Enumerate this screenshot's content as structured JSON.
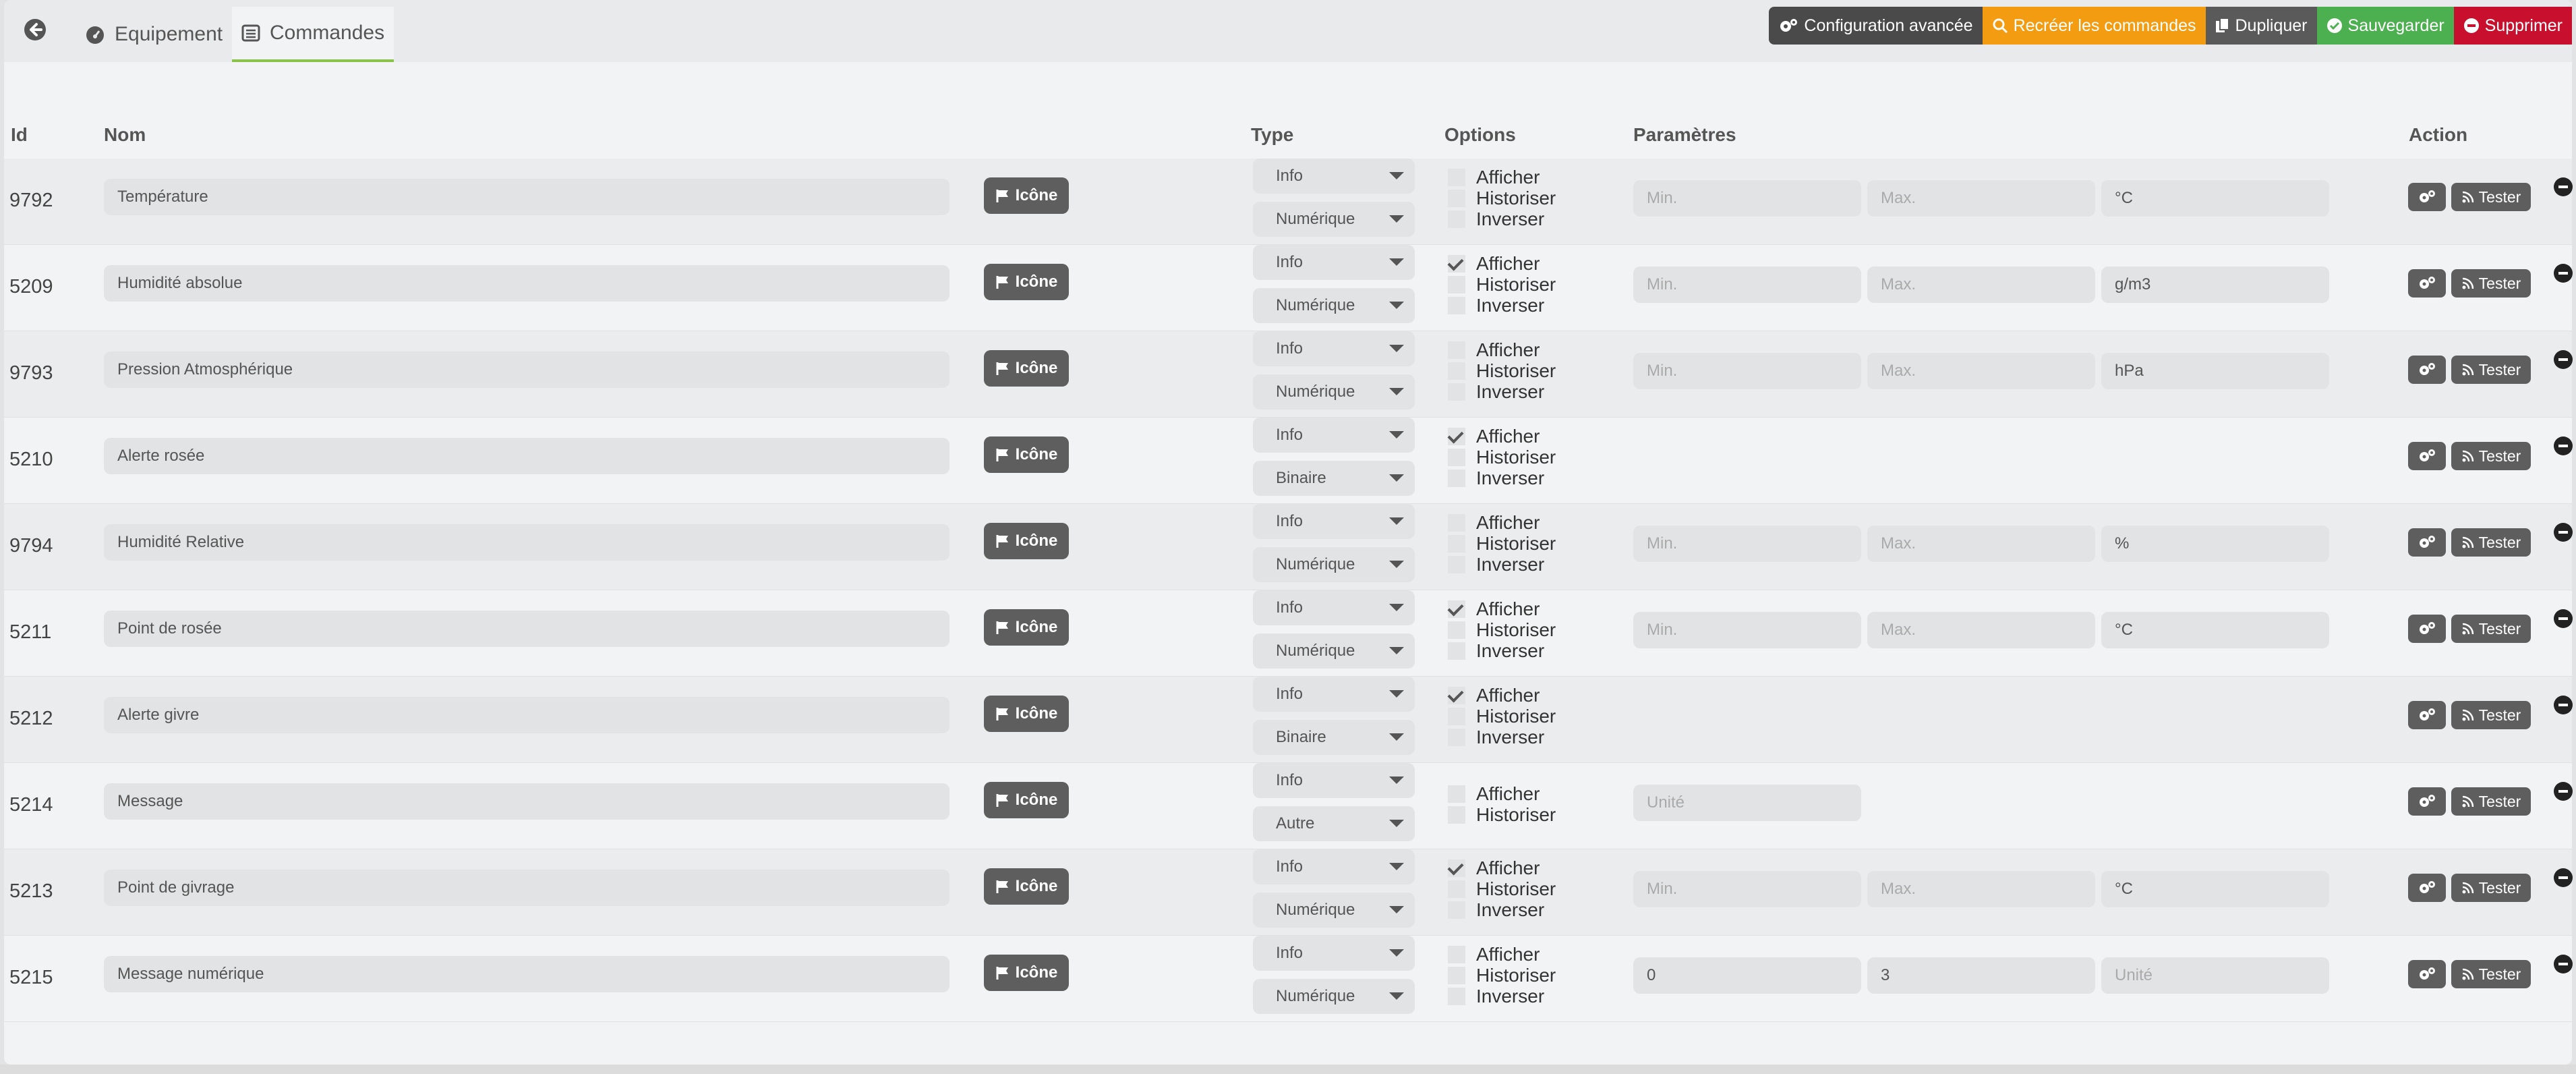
{
  "tabs": [
    {
      "label": "Equipement",
      "icon": "dashboard-icon"
    },
    {
      "label": "Commandes",
      "icon": "list-icon",
      "active": true
    }
  ],
  "actions": {
    "config": "Configuration avancée",
    "recreate": "Recréer les commandes",
    "duplicate": "Dupliquer",
    "save": "Sauvegarder",
    "delete": "Supprimer"
  },
  "colors": {
    "orange": "#f39c12",
    "green": "#4caf50",
    "red": "#c8102e",
    "dark": "#4a4a4a",
    "tab_active": "#8bc34a"
  },
  "table": {
    "headers": {
      "id": "Id",
      "nom": "Nom",
      "type": "Type",
      "options": "Options",
      "params": "Paramètres",
      "action": "Action"
    },
    "icon_label": "Icône",
    "test_label": "Tester",
    "rows": [
      {
        "id": "9792",
        "name": "Température",
        "type": "Info",
        "subtype": "Numérique",
        "afficher": false,
        "inverser": true,
        "params": [
          {
            "value": "",
            "placeholder": "Min."
          },
          {
            "value": "",
            "placeholder": "Max."
          },
          {
            "value": "°C",
            "placeholder": "Unité"
          }
        ]
      },
      {
        "id": "5209",
        "name": "Humidité absolue",
        "type": "Info",
        "subtype": "Numérique",
        "afficher": true,
        "inverser": true,
        "params": [
          {
            "value": "",
            "placeholder": "Min."
          },
          {
            "value": "",
            "placeholder": "Max."
          },
          {
            "value": "g/m3",
            "placeholder": "Unité"
          }
        ]
      },
      {
        "id": "9793",
        "name": "Pression Atmosphérique",
        "type": "Info",
        "subtype": "Numérique",
        "afficher": false,
        "inverser": true,
        "params": [
          {
            "value": "",
            "placeholder": "Min."
          },
          {
            "value": "",
            "placeholder": "Max."
          },
          {
            "value": "hPa",
            "placeholder": "Unité"
          }
        ]
      },
      {
        "id": "5210",
        "name": "Alerte rosée",
        "type": "Info",
        "subtype": "Binaire",
        "afficher": true,
        "inverser": true,
        "params": []
      },
      {
        "id": "9794",
        "name": "Humidité Relative",
        "type": "Info",
        "subtype": "Numérique",
        "afficher": false,
        "inverser": true,
        "params": [
          {
            "value": "",
            "placeholder": "Min."
          },
          {
            "value": "",
            "placeholder": "Max."
          },
          {
            "value": "%",
            "placeholder": "Unité"
          }
        ]
      },
      {
        "id": "5211",
        "name": "Point de rosée",
        "type": "Info",
        "subtype": "Numérique",
        "afficher": true,
        "inverser": true,
        "params": [
          {
            "value": "",
            "placeholder": "Min."
          },
          {
            "value": "",
            "placeholder": "Max."
          },
          {
            "value": "°C",
            "placeholder": "Unité"
          }
        ]
      },
      {
        "id": "5212",
        "name": "Alerte givre",
        "type": "Info",
        "subtype": "Binaire",
        "afficher": true,
        "inverser": true,
        "params": []
      },
      {
        "id": "5214",
        "name": "Message",
        "type": "Info",
        "subtype": "Autre",
        "afficher": false,
        "inverser": false,
        "params": [
          {
            "value": "",
            "placeholder": "Unité"
          }
        ]
      },
      {
        "id": "5213",
        "name": "Point de givrage",
        "type": "Info",
        "subtype": "Numérique",
        "afficher": true,
        "inverser": true,
        "params": [
          {
            "value": "",
            "placeholder": "Min."
          },
          {
            "value": "",
            "placeholder": "Max."
          },
          {
            "value": "°C",
            "placeholder": "Unité"
          }
        ]
      },
      {
        "id": "5215",
        "name": "Message numérique",
        "type": "Info",
        "subtype": "Numérique",
        "afficher": false,
        "inverser": true,
        "params": [
          {
            "value": "0",
            "placeholder": "Min."
          },
          {
            "value": "3",
            "placeholder": "Max."
          },
          {
            "value": "",
            "placeholder": "Unité"
          }
        ]
      }
    ],
    "option_labels": {
      "afficher": "Afficher",
      "historiser": "Historiser",
      "inverser": "Inverser"
    }
  }
}
